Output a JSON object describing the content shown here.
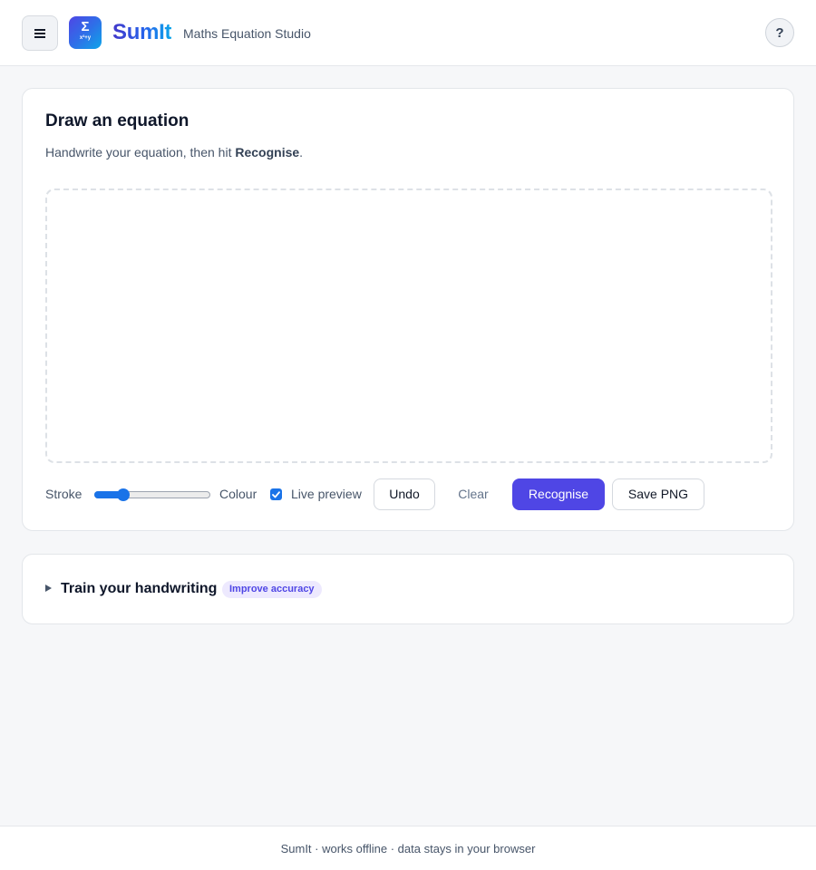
{
  "header": {
    "menu_icon": "hamburger-menu-icon",
    "logo": {
      "symbol": "Σ",
      "sub": "x²+y",
      "icon": "sigma-logo-icon"
    },
    "brand": "SumIt",
    "tagline": "Maths Equation Studio",
    "help_label": "?"
  },
  "draw_card": {
    "title": "Draw an equation",
    "subtitle_prefix": "Handwrite your equation, then hit ",
    "subtitle_emphasis": "Recognise",
    "subtitle_suffix": ".",
    "toolbar": {
      "stroke_label": "Stroke",
      "stroke_value_fraction": 0.22,
      "colour_label": "Colour",
      "live_preview_label": "Live preview",
      "live_preview_checked": true,
      "undo_label": "Undo",
      "clear_label": "Clear",
      "recognise_label": "Recognise",
      "save_label": "Save PNG"
    }
  },
  "train_card": {
    "title": "Train your handwriting",
    "badge": "Improve accuracy",
    "expanded": false
  },
  "footer": {
    "text": "SumIt · works offline · data stays in your browser"
  },
  "colors": {
    "accent": "#4f46e5",
    "slider": "#1a73e8",
    "badge_bg": "#ede9fe"
  }
}
